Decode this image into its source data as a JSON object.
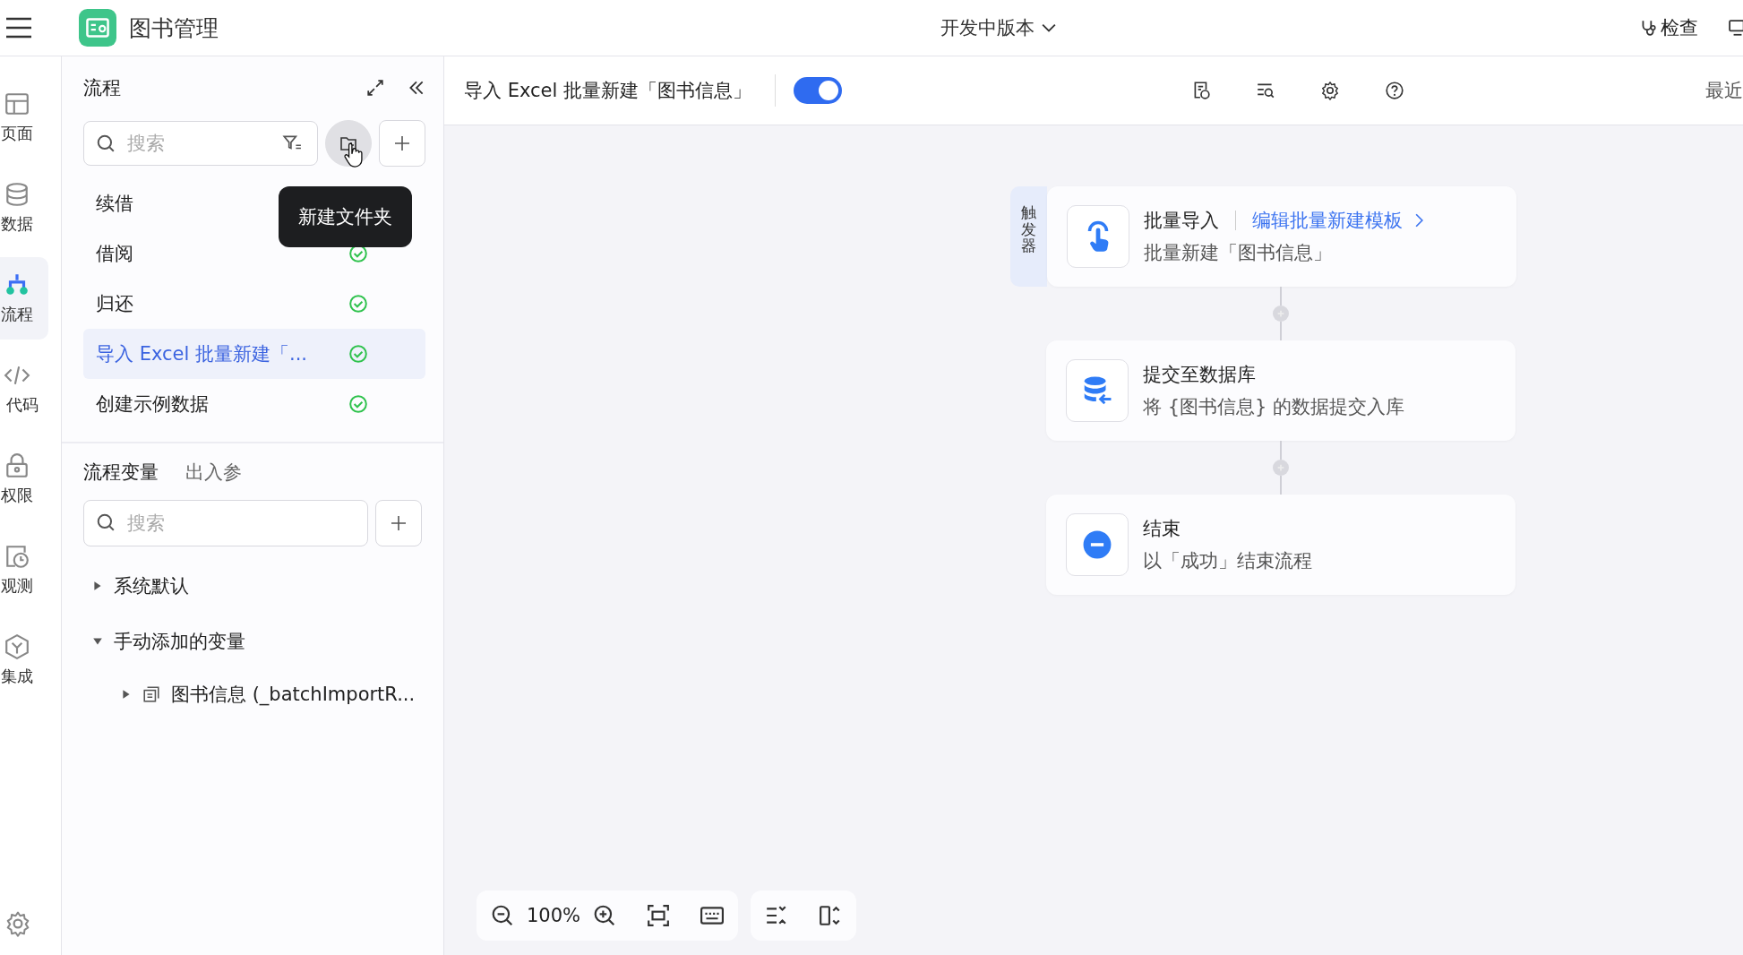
{
  "app": {
    "title": "图书管理",
    "version": "开发中版本",
    "check": "检查"
  },
  "rail": [
    {
      "label": "页面",
      "kind": "page",
      "selected": false
    },
    {
      "label": "数据",
      "kind": "data",
      "selected": false
    },
    {
      "label": "流程",
      "kind": "flow",
      "selected": true
    },
    {
      "label": "代码",
      "kind": "code",
      "selected": false
    },
    {
      "label": "权限",
      "kind": "lock",
      "selected": false
    },
    {
      "label": "观测",
      "kind": "observe",
      "selected": false
    },
    {
      "label": "集成",
      "kind": "integrate",
      "selected": false
    }
  ],
  "flows_panel": {
    "title": "流程",
    "search": {
      "placeholder": "搜索"
    },
    "tooltip": "新建文件夹",
    "items": [
      {
        "name": "续借",
        "selected": false
      },
      {
        "name": "借阅",
        "selected": false,
        "published": true
      },
      {
        "name": "归还",
        "selected": false,
        "published": true
      },
      {
        "name": "导入 Excel 批量新建「...",
        "selected": true,
        "published": true
      },
      {
        "name": "创建示例数据",
        "selected": false,
        "published": true
      }
    ]
  },
  "variables_panel": {
    "tabs": [
      {
        "label": "流程变量",
        "selected": true
      },
      {
        "label": "出入参",
        "selected": false
      }
    ],
    "search": {
      "placeholder": "搜索"
    },
    "tree": [
      {
        "label": "系统默认",
        "expanded": false
      },
      {
        "label": "手动添加的变量",
        "expanded": true,
        "children": [
          {
            "label": "图书信息 (_batchImportR...",
            "expanded": false
          }
        ]
      }
    ]
  },
  "canvas": {
    "title": "导入 Excel 批量新建「图书信息」",
    "enabled": true,
    "recent": "最近",
    "nodes": [
      {
        "kind": "trigger",
        "badge": "触发器",
        "title": "批量导入",
        "link": "编辑批量新建模板",
        "subtitle": "批量新建「图书信息」"
      },
      {
        "kind": "database",
        "title": "提交至数据库",
        "subtitle": "将 {图书信息} 的数据提交入库"
      },
      {
        "kind": "end",
        "title": "结束",
        "subtitle": "以「成功」结束流程"
      }
    ],
    "zoom": "100%"
  }
}
